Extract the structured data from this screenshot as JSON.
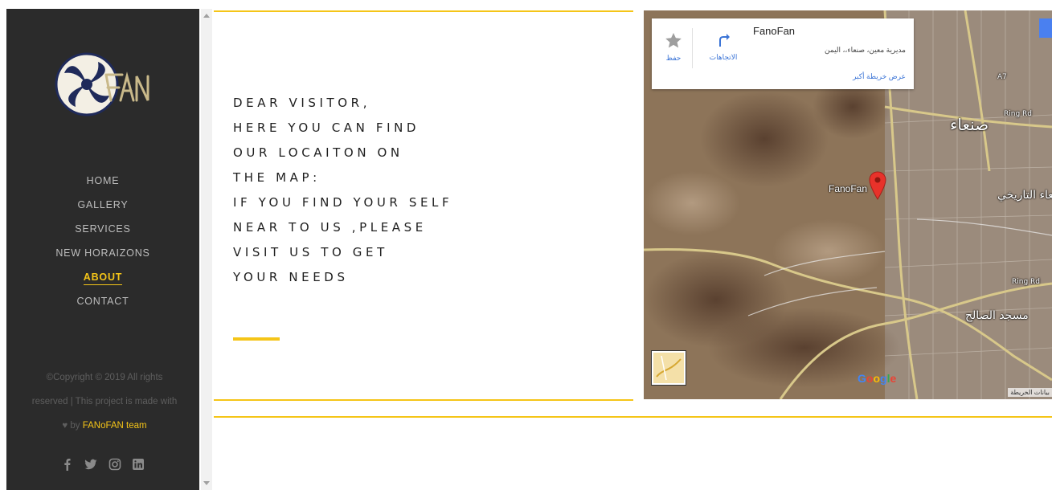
{
  "sidebar": {
    "nav": [
      {
        "label": "HOME",
        "active": false
      },
      {
        "label": "GALLERY",
        "active": false
      },
      {
        "label": "SERVICES",
        "active": false
      },
      {
        "label": "NEW HORAIZONS",
        "active": false
      },
      {
        "label": "ABOUT",
        "active": true
      },
      {
        "label": "CONTACT",
        "active": false
      }
    ],
    "copyright_line1": "©Copyright © 2019 All rights",
    "copyright_line2": "reserved | This project is made with",
    "copyright_heart": "♥",
    "copyright_by": " by ",
    "copyright_team": "FANoFAN team",
    "social_icons": [
      "facebook-icon",
      "twitter-icon",
      "instagram-icon",
      "linkedin-icon"
    ]
  },
  "content": {
    "message_lines": [
      "DEAR VISITOR,",
      "HERE YOU CAN FIND",
      "OUR LOCAITON ON",
      "THE MAP:",
      "IF YOU FIND YOUR SELF",
      "NEAR TO US ,PLEASE",
      "VISIT US TO GET",
      "YOUR NEEDS"
    ]
  },
  "map": {
    "place_name": "FanoFan",
    "address": "مديرية معين، صنعاء،، اليمن",
    "save_label": "حفظ",
    "directions_label": "الاتجاهات",
    "larger_map_link": "عرض خريطة أكبر",
    "pin_label": "FanoFan",
    "google_logo": [
      "G",
      "o",
      "o",
      "g",
      "l",
      "e"
    ],
    "credit": "بيانات الخريطة",
    "labels": {
      "sanaa": "صنعاء",
      "old_city": "صنعاء التاريخي",
      "saleh_mosque": "مسجد الصالح",
      "ring_rd": "Ring Rd",
      "a7": "A7"
    }
  },
  "colors": {
    "accent": "#f5c518",
    "sidebar_bg": "#2b2b2b"
  }
}
